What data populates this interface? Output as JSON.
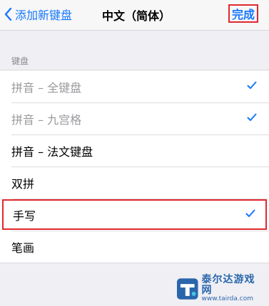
{
  "navbar": {
    "back_label": "添加新键盘",
    "title": "中文（简体）",
    "done_label": "完成"
  },
  "section": {
    "header": "键盘"
  },
  "keyboards": [
    {
      "label": "拼音 – 全键盘",
      "checked": true,
      "disabled": true
    },
    {
      "label": "拼音 – 九宫格",
      "checked": true,
      "disabled": true
    },
    {
      "label": "拼音 – 法文键盘",
      "checked": false,
      "disabled": false
    },
    {
      "label": "双拼",
      "checked": false,
      "disabled": false
    },
    {
      "label": "手写",
      "checked": true,
      "disabled": false,
      "highlighted": true
    },
    {
      "label": "笔画",
      "checked": false,
      "disabled": false
    }
  ],
  "watermark": {
    "name": "泰尔达游戏网",
    "url": "www.tairda.com"
  },
  "colors": {
    "accent": "#1677ff",
    "highlight_border": "#e0282e",
    "background": "#efeff4"
  }
}
